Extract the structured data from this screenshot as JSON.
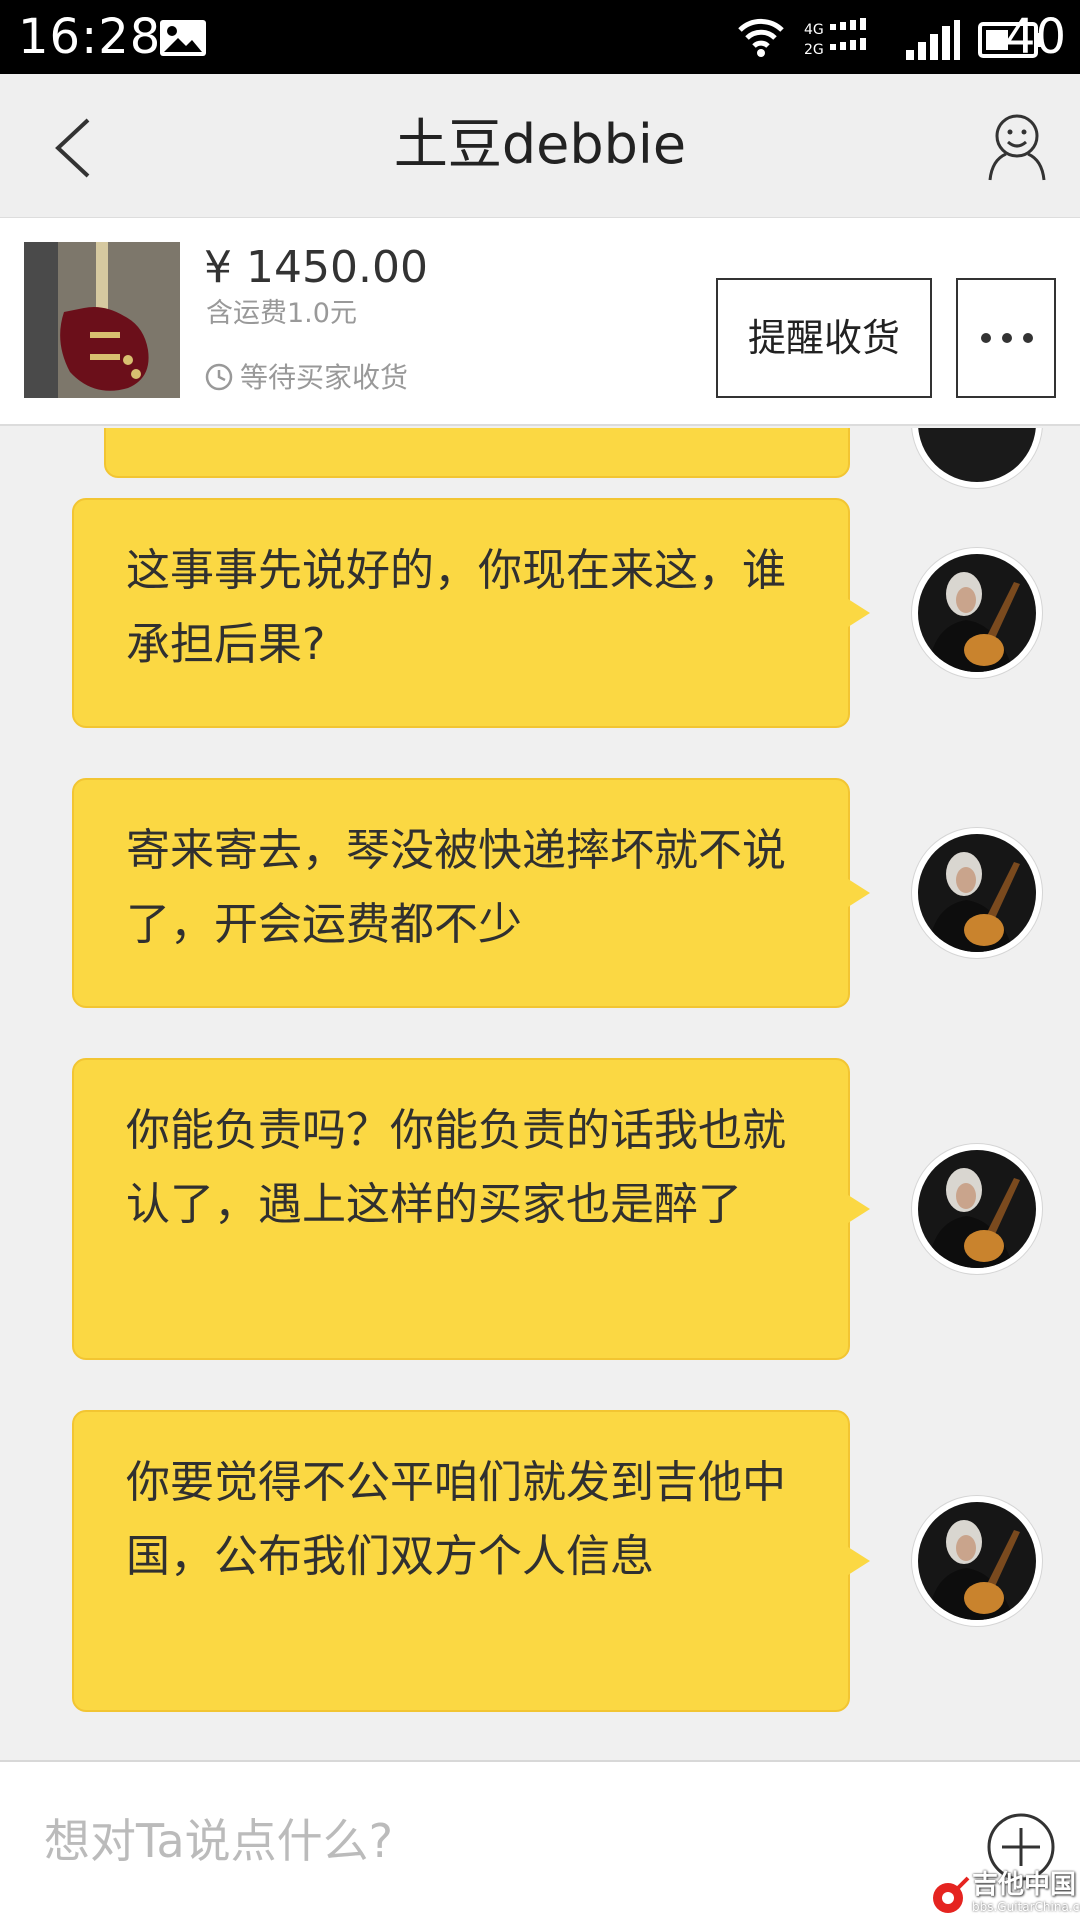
{
  "status_bar": {
    "time": "16:28",
    "battery": "40",
    "network_top": "4G",
    "network_bottom": "2G",
    "icons": [
      "image-icon",
      "wifi-icon",
      "network-icon",
      "signal-icon",
      "battery-icon"
    ]
  },
  "header": {
    "title": "土豆debbie",
    "back_icon": "back-icon",
    "profile_icon": "profile-icon"
  },
  "order": {
    "price": "¥ 1450.00",
    "shipping": "含运费1.0元",
    "status": "等待买家收货",
    "remind_button": "提醒收货",
    "more_icon": "more-icon"
  },
  "messages": [
    {
      "text": "这事事先说好的，你现在来这，谁承担后果?",
      "sender": "self"
    },
    {
      "text": "寄来寄去，琴没被快递摔坏就不说了，开会运费都不少",
      "sender": "self"
    },
    {
      "text": "你能负责吗？你能负责的话我也就认了，遇上这样的买家也是醉了",
      "sender": "self"
    },
    {
      "text": "你要觉得不公平咱们就发到吉他中国，公布我们双方个人信息",
      "sender": "self"
    }
  ],
  "input": {
    "placeholder": "想对Ta说点什么?",
    "add_icon": "add-icon"
  },
  "watermark": {
    "name": "吉他中国",
    "url": "bbs.GuitarChina.com"
  },
  "colors": {
    "bubble": "#fbd843",
    "background": "#f0f0f0",
    "status_bar": "#000000"
  }
}
